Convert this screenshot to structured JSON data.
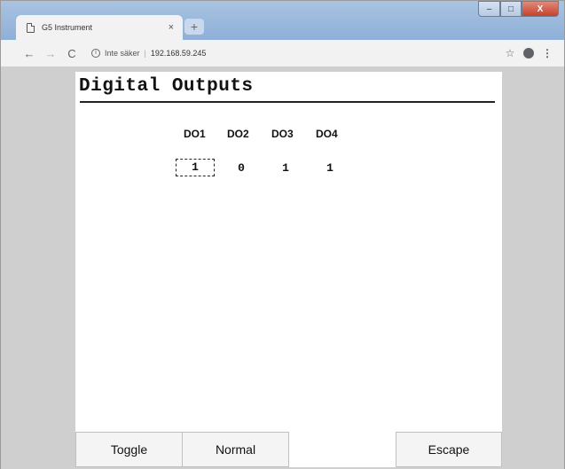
{
  "browser": {
    "tab_title": "G5 Instrument",
    "tab_close": "×",
    "new_tab": "+",
    "security_label": "Inte säker",
    "url": "192.168.59.245",
    "window_controls": {
      "minimize": "–",
      "maximize": "□",
      "close": "X"
    }
  },
  "panel": {
    "title": "Digital Outputs",
    "outputs": [
      {
        "label": "DO1",
        "value": "1"
      },
      {
        "label": "DO2",
        "value": "0"
      },
      {
        "label": "DO3",
        "value": "1"
      },
      {
        "label": "DO4",
        "value": "1"
      }
    ],
    "buttons": {
      "toggle": "Toggle",
      "normal": "Normal",
      "escape": "Escape"
    }
  }
}
